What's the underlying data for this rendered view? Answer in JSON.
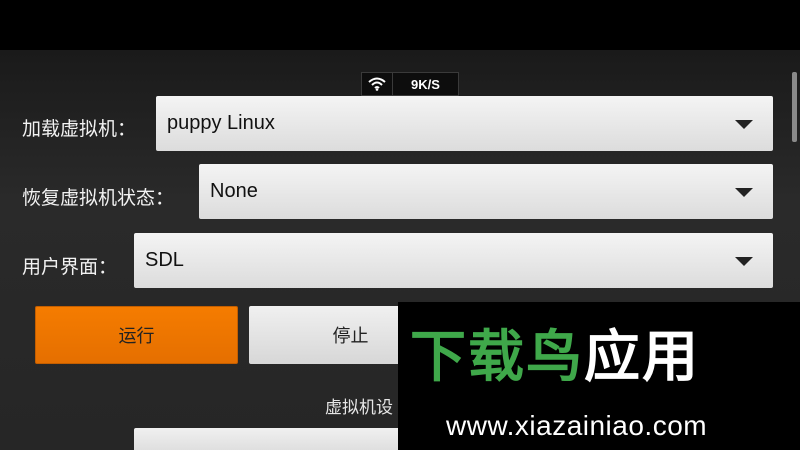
{
  "status": {
    "net_speed": "9K/S",
    "wifi_icon": "wifi-icon"
  },
  "form": {
    "vm_label": "加载虚拟机：",
    "vm_value": "puppy Linux",
    "state_label": "恢复虚拟机状态：",
    "state_value": "None",
    "ui_label": "用户界面：",
    "ui_value": "SDL"
  },
  "buttons": {
    "run": "运行",
    "stop": "停止"
  },
  "section": {
    "settings_label": "虚拟机设"
  },
  "watermark": {
    "title_green": "下载鸟",
    "title_white": "应用",
    "url": "www.xiazainiao.com"
  },
  "colors": {
    "run_button": "#f57c00",
    "background": "#262626",
    "watermark_green": "#3fa84a"
  }
}
